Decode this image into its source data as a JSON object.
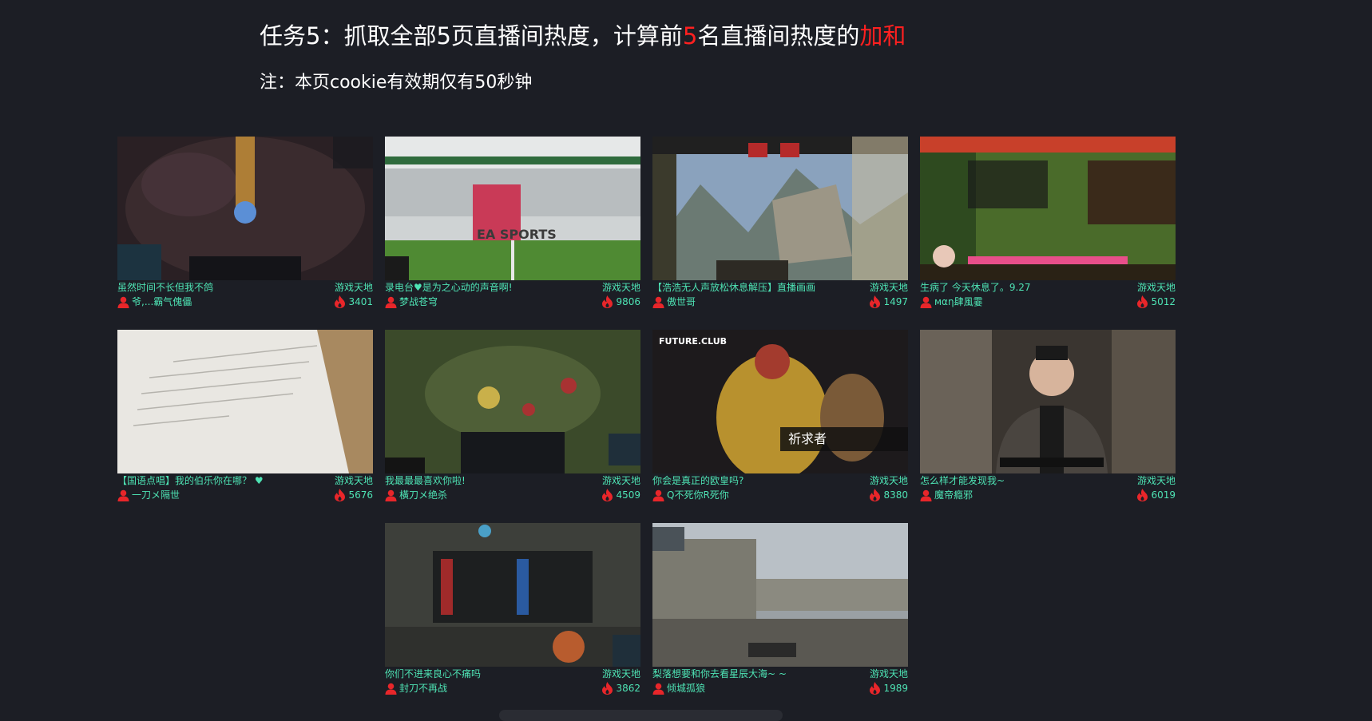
{
  "header": {
    "title_prefix": "任务5：抓取全部5页直播间热度，计算前",
    "title_num": "5",
    "title_mid": "名直播间热度的",
    "title_suffix": "加和",
    "note": "注：本页cookie有效期仅有50秒钟"
  },
  "colors": {
    "background": "#1c1e25",
    "text_accent": "#4ee3b4",
    "highlight": "#ff2020",
    "fire": "#e8262a"
  },
  "rooms": [
    {
      "name": "虽然时间不长但我不鸽",
      "category": "游戏天地",
      "anchor": "爷,...霸气傀儡",
      "heat": "3401",
      "icon": "user-icon"
    },
    {
      "name": "录电台♥是为之心动的声音啊!",
      "category": "游戏天地",
      "anchor": "梦战苍穹",
      "heat": "9806",
      "icon": "user-icon"
    },
    {
      "name": "【浩浩无人声放松休息解压】直播画画",
      "category": "游戏天地",
      "anchor": "傲世哥",
      "heat": "1497",
      "icon": "user-icon"
    },
    {
      "name": "生病了 今天休息了。9.27",
      "category": "游戏天地",
      "anchor": "мαη肆風霎",
      "heat": "5012",
      "icon": "user-icon"
    },
    {
      "name": "【国语点唱】我的伯乐你在哪？ ♥",
      "category": "游戏天地",
      "anchor": "一刀メ隔世",
      "heat": "5676",
      "icon": "user-icon"
    },
    {
      "name": "我最最最喜欢你啦!",
      "category": "游戏天地",
      "anchor": "橫刀メ绝杀",
      "heat": "4509",
      "icon": "user-icon"
    },
    {
      "name": "你会是真正的欧皇吗?",
      "category": "游戏天地",
      "anchor": "Q不死你R死你",
      "heat": "8380",
      "icon": "user-icon"
    },
    {
      "name": "怎么样才能发现我~",
      "category": "游戏天地",
      "anchor": "魔帝瘾邪",
      "heat": "6019",
      "icon": "user-icon"
    },
    {
      "name": "你们不进来良心不痛吗",
      "category": "游戏天地",
      "anchor": "封刀不再战",
      "heat": "3862",
      "icon": "user-icon"
    },
    {
      "name": "梨落想要和你去看星辰大海~ ~",
      "category": "游戏天地",
      "anchor": "倾城孤狼",
      "heat": "1989",
      "icon": "user-icon"
    }
  ],
  "thumb_texts": {
    "ea": "EA SPORTS",
    "future": "FUTURE.CLUB",
    "qiqiu": "祈求者"
  }
}
